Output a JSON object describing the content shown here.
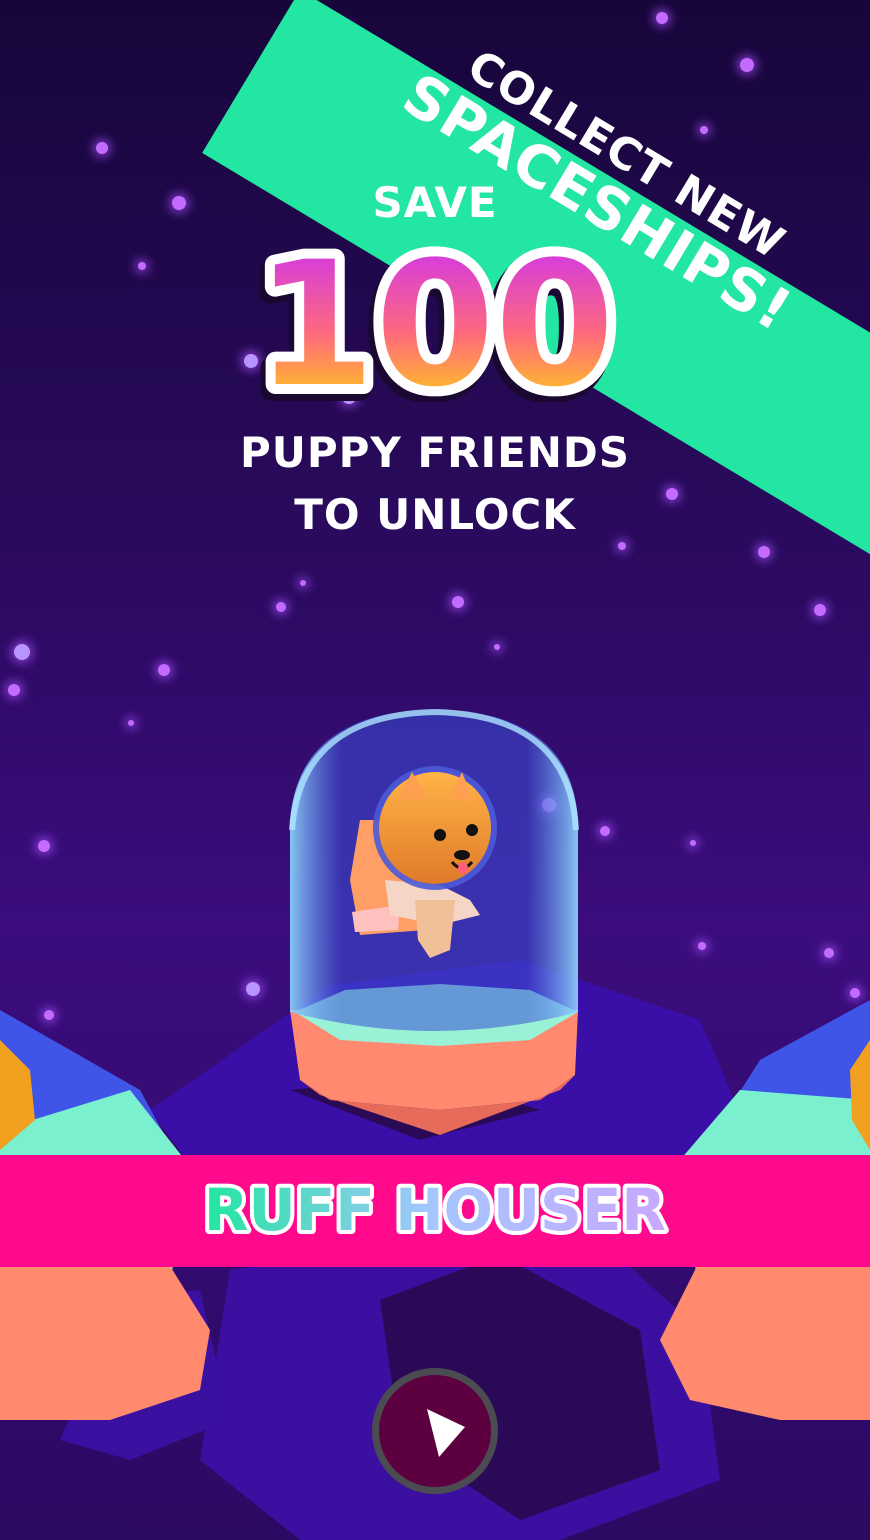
{
  "promo_ribbon": {
    "line1": "COLLECT NEW",
    "line2": "SPACESHIPS!",
    "color": "#22e6a1"
  },
  "headline": {
    "save": "SAVE",
    "count": "100",
    "line1": "PUPPY FRIENDS",
    "line2": "TO UNLOCK"
  },
  "character": {
    "name": "RUFF HOUSER",
    "banner_color": "#ff0a8c"
  },
  "controls": {
    "play_icon": "play-icon"
  }
}
